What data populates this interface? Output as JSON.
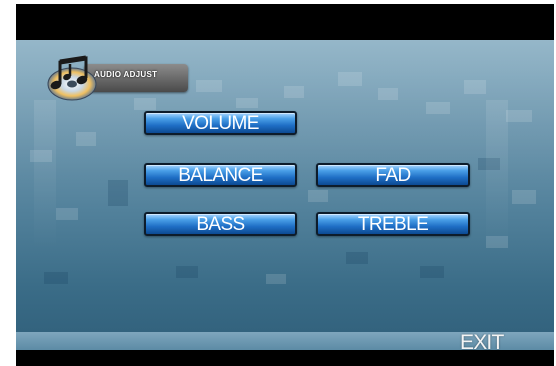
{
  "header": {
    "title": "AUDIO ADJUST",
    "icon": "music-notes-disc-icon"
  },
  "menu": {
    "volume": "VOLUME",
    "balance": "BALANCE",
    "fad": "FAD",
    "bass": "BASS",
    "treble": "TREBLE"
  },
  "footer": {
    "exit": "EXIT"
  },
  "colors": {
    "button_top": "#a9d6ff",
    "button_bottom": "#0c4a92",
    "background_top": "#8fb3c6",
    "background_bottom": "#305f7a"
  }
}
